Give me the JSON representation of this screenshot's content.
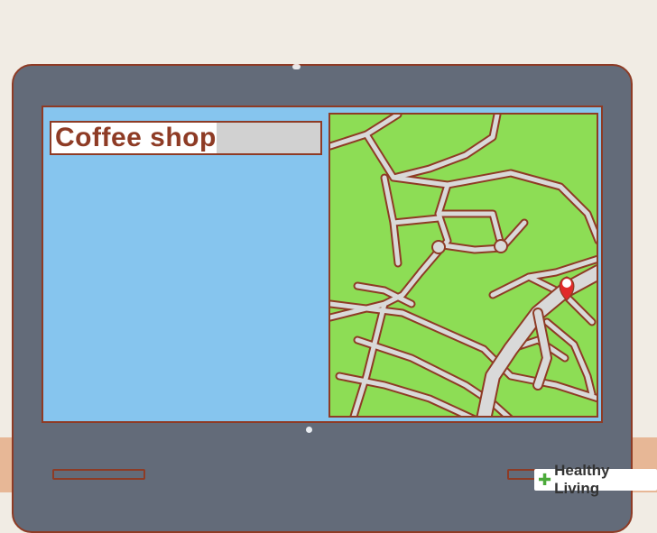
{
  "search": {
    "query": "Coffee shop"
  },
  "map": {
    "pin_color": "#e12a2a",
    "land_color": "#8ddd55",
    "road_color": "#d9d9d9",
    "outline_color": "#8e3b25"
  },
  "watermark": {
    "brand": "Healthy Living",
    "icon": "leaf-icon"
  },
  "colors": {
    "screen": "#86c5ee",
    "bezel": "#636b79",
    "floor": "#e7b796",
    "wall": "#f1ece4"
  }
}
